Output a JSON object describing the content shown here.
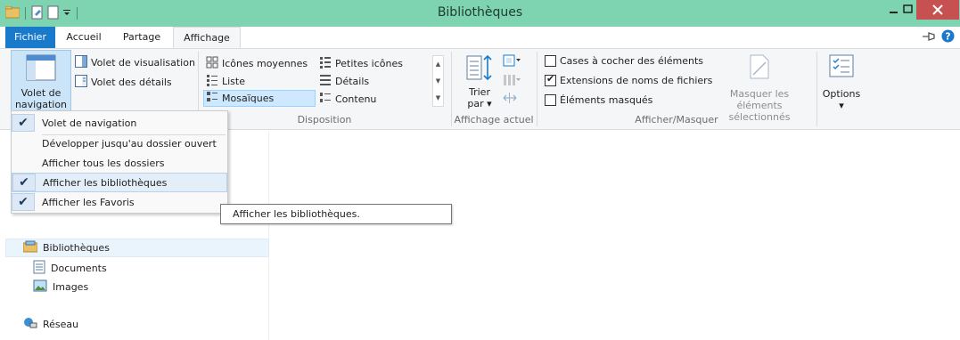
{
  "window": {
    "title": "Bibliothèques",
    "close_color": "#c75050",
    "titlebar_color": "#7ed3b1"
  },
  "tabs": [
    {
      "label": "Fichier"
    },
    {
      "label": "Accueil"
    },
    {
      "label": "Partage"
    },
    {
      "label": "Affichage"
    }
  ],
  "ribbon": {
    "volets": {
      "nav_pane_label_line1": "Volet de",
      "nav_pane_label_line2": "navigation",
      "preview_pane": "Volet de visualisation",
      "details_pane": "Volet des détails"
    },
    "disposition": {
      "group_label": "Disposition",
      "items": [
        {
          "label": "Icônes moyennes"
        },
        {
          "label": "Petites icônes"
        },
        {
          "label": "Liste"
        },
        {
          "label": "Détails"
        },
        {
          "label": "Mosaïques",
          "selected": true
        },
        {
          "label": "Contenu"
        }
      ]
    },
    "affichage_actuel": {
      "group_label": "Affichage actuel",
      "sort_line1": "Trier",
      "sort_line2": "par"
    },
    "afficher_masquer": {
      "group_label": "Afficher/Masquer",
      "checkboxes": [
        {
          "label": "Cases à cocher des éléments",
          "checked": false
        },
        {
          "label": "Extensions de noms de fichiers",
          "checked": true
        },
        {
          "label": "Éléments masqués",
          "checked": false
        }
      ],
      "hide_selected_line1": "Masquer les éléments",
      "hide_selected_line2": "sélectionnés"
    },
    "options": {
      "label": "Options"
    }
  },
  "dropdown": {
    "items": [
      {
        "label": "Volet de navigation",
        "checked": true
      },
      {
        "label": "Développer jusqu'au dossier ouvert",
        "checked": false
      },
      {
        "label": "Afficher tous les dossiers",
        "checked": false
      },
      {
        "label": "Afficher les bibliothèques",
        "checked": true,
        "hover": true
      },
      {
        "label": "Afficher les Favoris",
        "checked": true
      }
    ]
  },
  "tooltip": {
    "text": "Afficher les bibliothèques."
  },
  "navpane": {
    "libraries": "Bibliothèques",
    "documents": "Documents",
    "images": "Images",
    "network": "Réseau"
  }
}
